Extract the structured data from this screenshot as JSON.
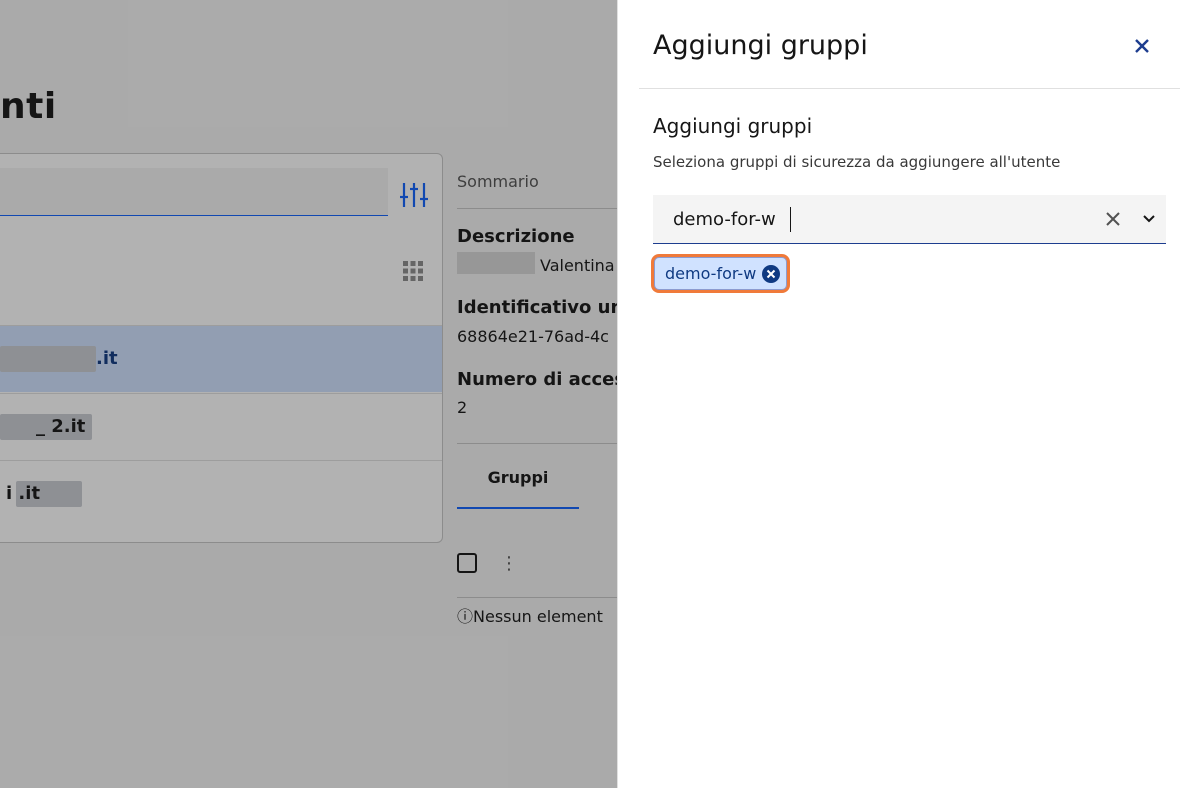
{
  "background": {
    "page_title": "nti",
    "list_items": [
      {
        "label": ".it"
      },
      {
        "label": "_ 2.it"
      },
      {
        "label": "i .it"
      }
    ],
    "detail": {
      "summary_label": "Sommario",
      "description_heading": "Descrizione",
      "description_value": "Valentina",
      "identifier_heading": "Identificativo un",
      "identifier_value": "68864e21-76ad-4c",
      "access_heading": "Numero di acces",
      "access_value": "2",
      "tab_groups": "Gruppi",
      "empty_message": "Nessun element"
    }
  },
  "panel": {
    "title": "Aggiungi gruppi",
    "section_title": "Aggiungi gruppi",
    "section_description": "Seleziona gruppi di sicurezza da aggiungere all'utente",
    "combo_value": "demo-for-w",
    "selected_tags": [
      "demo-for-w"
    ]
  },
  "colors": {
    "accent": "#0f62fe",
    "highlight": "#f07a3a",
    "tag_bg": "#d0e2ff",
    "tag_text": "#0f3a82"
  },
  "icons": [
    "filter-icon",
    "grid-icon",
    "close-icon",
    "clear-icon",
    "chevron-down-icon",
    "tag-remove-icon",
    "info-icon",
    "overflow-menu-icon"
  ]
}
